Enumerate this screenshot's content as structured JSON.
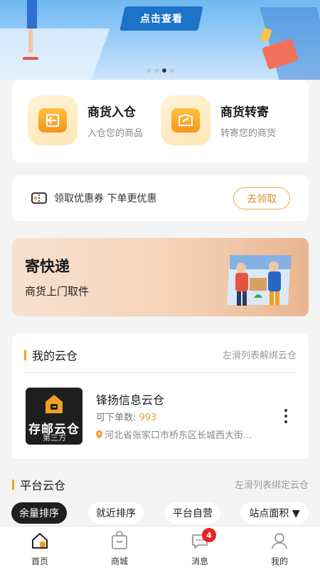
{
  "banner": {
    "cta_label": "点击查看",
    "page_count": 4,
    "active_page": 3
  },
  "entries": [
    {
      "title": "商货入仓",
      "subtitle": "入仓您的商品",
      "icon": "inbound-icon"
    },
    {
      "title": "商货转寄",
      "subtitle": "转寄您的商货",
      "icon": "forward-icon"
    }
  ],
  "coupon": {
    "text": "领取优惠券 下单更优惠",
    "button_label": "去领取",
    "icon": "ticket-icon"
  },
  "express": {
    "title": "寄快递",
    "subtitle": "商货上门取件"
  },
  "my_cloud": {
    "title": "我的云仓",
    "hint": "左滑列表解绑云仓",
    "warehouse": {
      "logo_text": "存邮云仓",
      "logo_sub": "第三方",
      "name": "锋扬信息云仓",
      "orders_label": "可下单数:",
      "orders_value": "993",
      "address": "河北省张家口市桥东区长城西大街…"
    }
  },
  "platform": {
    "title": "平台云仓",
    "hint": "左滑列表绑定云仓",
    "filters": [
      "余量排序",
      "就近排序",
      "平台自营",
      "站点面积 ▼"
    ],
    "active_filter": 0
  },
  "tabbar": {
    "items": [
      {
        "label": "首页",
        "icon": "home-icon",
        "active": true
      },
      {
        "label": "商城",
        "icon": "mall-icon",
        "active": false
      },
      {
        "label": "消息",
        "icon": "message-icon",
        "active": false,
        "badge": "4"
      },
      {
        "label": "我的",
        "icon": "profile-icon",
        "active": false
      }
    ]
  },
  "colors": {
    "accent": "#f0a020",
    "coupon_button": "#d4932a",
    "badge": "#e62222",
    "dark_chip": "#1f1f1f"
  }
}
